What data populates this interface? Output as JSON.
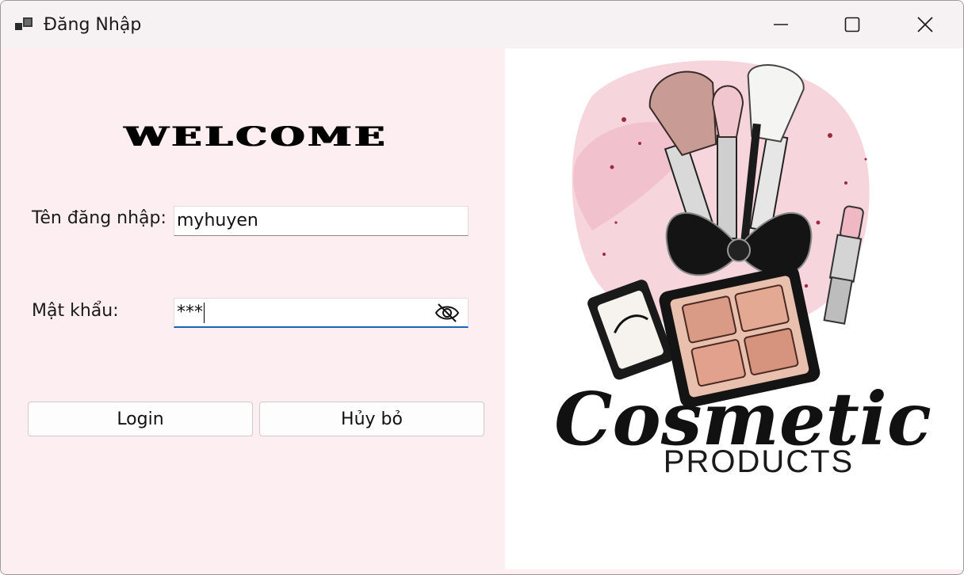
{
  "window": {
    "title": "Đăng Nhập",
    "icons": {
      "app": "app-icon",
      "minimize": "minimize-icon",
      "maximize": "maximize-icon",
      "close": "close-icon"
    }
  },
  "form": {
    "heading": "WELCOME",
    "username_label": "Tên đăng nhập:",
    "username_value": "myhuyen",
    "password_label": "Mật khẩu:",
    "password_value": "***",
    "password_toggle_icon": "eye-slash-icon",
    "login_label": "Login",
    "cancel_label": "Hủy bỏ"
  },
  "logo": {
    "title": "Cosmetic",
    "subtitle": "PRODUCTS"
  },
  "colors": {
    "panel_bg": "#fdeef2",
    "accent_blue": "#1a62b8",
    "logo_pink": "#f1bfcb",
    "splatter": "#9c2a3e"
  }
}
